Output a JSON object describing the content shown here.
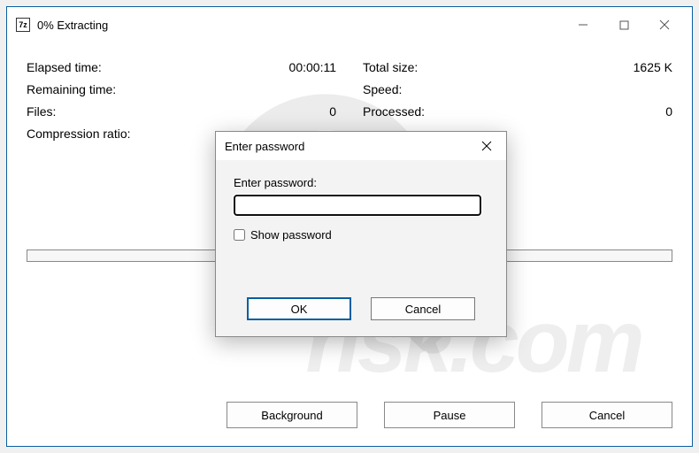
{
  "window": {
    "app_icon_text": "7z",
    "title": "0% Extracting"
  },
  "stats": {
    "left": {
      "elapsed_label": "Elapsed time:",
      "elapsed_value": "00:00:11",
      "remaining_label": "Remaining time:",
      "remaining_value": "",
      "files_label": "Files:",
      "files_value": "0",
      "ratio_label": "Compression ratio:",
      "ratio_value": ""
    },
    "right": {
      "total_label": "Total size:",
      "total_value": "1625 K",
      "speed_label": "Speed:",
      "speed_value": "",
      "processed_label": "Processed:",
      "processed_value": "0"
    }
  },
  "buttons": {
    "background": "Background",
    "pause": "Pause",
    "cancel": "Cancel"
  },
  "dialog": {
    "title": "Enter password",
    "field_label": "Enter password:",
    "password_value": "",
    "show_password_label": "Show password",
    "ok": "OK",
    "cancel": "Cancel"
  },
  "watermark": {
    "text": "risk.com"
  }
}
